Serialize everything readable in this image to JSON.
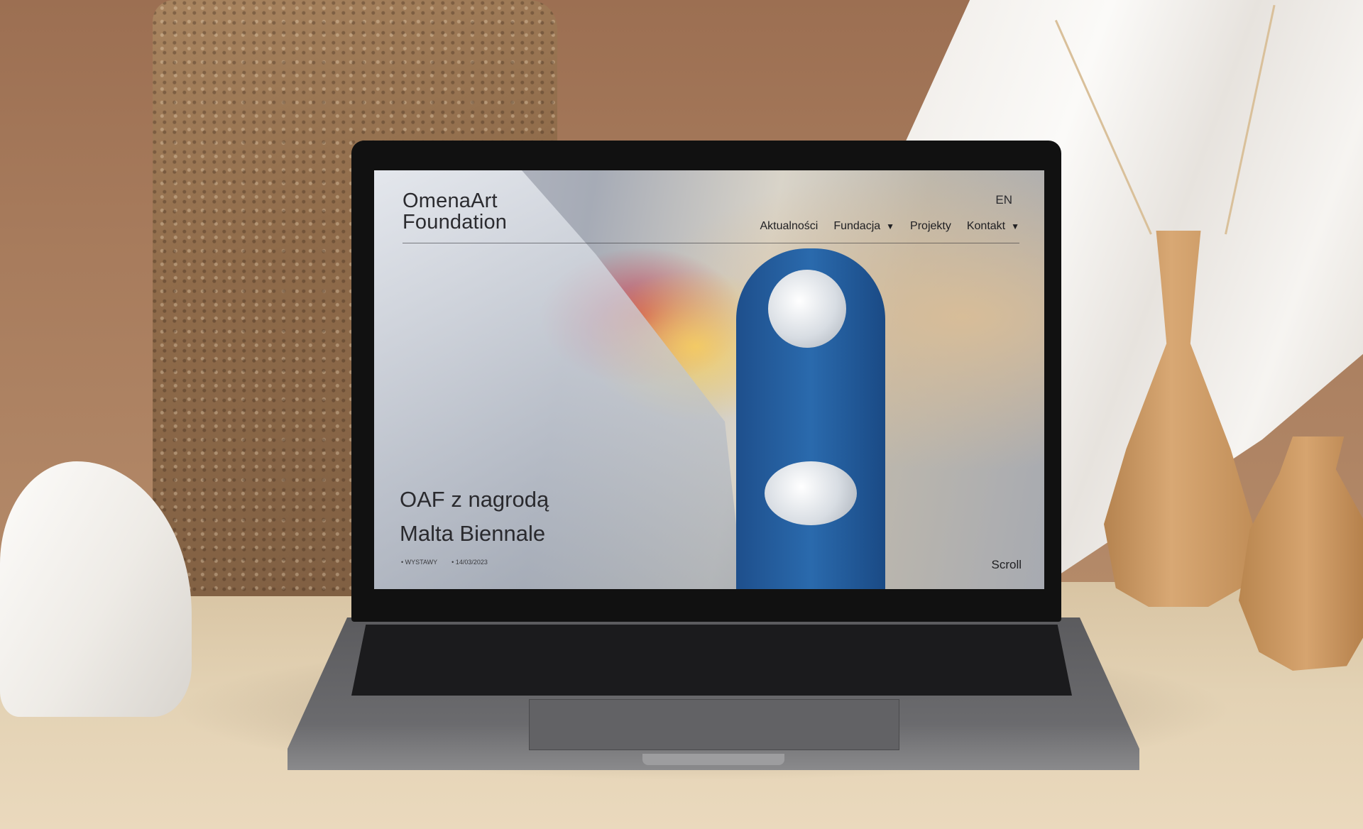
{
  "website": {
    "logo": {
      "line1": "OmenaArt",
      "line2": "Foundation"
    },
    "language": "EN",
    "nav": [
      {
        "label": "Aktualności",
        "has_dropdown": false
      },
      {
        "label": "Fundacja",
        "has_dropdown": true
      },
      {
        "label": "Projekty",
        "has_dropdown": false
      },
      {
        "label": "Kontakt",
        "has_dropdown": true
      }
    ],
    "dropdown_glyph": "▼",
    "hero": {
      "title_line1": "OAF z nagrodą",
      "title_line2": "Malta Biennale",
      "meta": [
        "• WYSTAWY",
        "• 14/03/2023"
      ]
    },
    "scroll_label": "Scroll"
  },
  "scene": {
    "icons": [
      "laptop",
      "stone",
      "vase",
      "cloth"
    ]
  }
}
